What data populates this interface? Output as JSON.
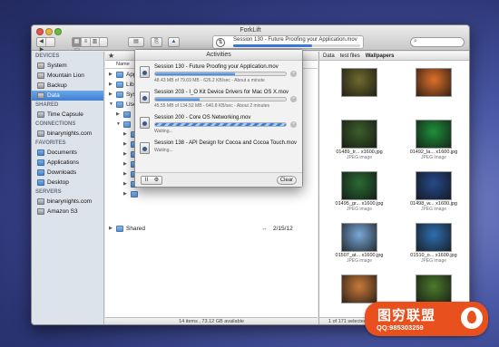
{
  "window": {
    "title": "ForkLift"
  },
  "toolbar": {
    "nav_back": "◀",
    "nav_forward": "▶",
    "search_icon": "search-icon",
    "search_glyph": "⌕"
  },
  "activity_status": {
    "label": "Session 130 - Future Proofing your Application.mov",
    "progress": 0.62,
    "icon": "⇅"
  },
  "sidebar": {
    "sections": [
      {
        "heading": "DEVICES",
        "items": [
          {
            "label": "System",
            "icon": "disk-icon"
          },
          {
            "label": "Mountain Lion",
            "icon": "disk-icon"
          },
          {
            "label": "Backup",
            "icon": "disk-icon"
          },
          {
            "label": "Data",
            "icon": "disk-icon",
            "selected": true
          }
        ]
      },
      {
        "heading": "SHARED",
        "items": [
          {
            "label": "Time Capsule",
            "icon": "network-icon"
          }
        ]
      },
      {
        "heading": "CONNECTIONS",
        "items": [
          {
            "label": "binarynights.com",
            "icon": "server-icon"
          }
        ]
      },
      {
        "heading": "FAVORITES",
        "items": [
          {
            "label": "Documents",
            "icon": "folder-icon"
          },
          {
            "label": "Applications",
            "icon": "folder-icon"
          },
          {
            "label": "Downloads",
            "icon": "folder-icon"
          },
          {
            "label": "Desktop",
            "icon": "folder-icon"
          }
        ]
      },
      {
        "heading": "SERVERS",
        "items": [
          {
            "label": "binarynights.com",
            "icon": "server-icon"
          },
          {
            "label": "Amazon S3",
            "icon": "server-icon"
          }
        ]
      }
    ]
  },
  "left_pane": {
    "column_name": "Name",
    "rows": [
      {
        "label": "App",
        "tri": "▶"
      },
      {
        "label": "Lib",
        "tri": "▶"
      },
      {
        "label": "Sys",
        "tri": "▶"
      },
      {
        "label": "Use",
        "tri": "▼"
      },
      {
        "label": "",
        "tri": "▶"
      },
      {
        "label": "",
        "tri": "▼"
      },
      {
        "label": "",
        "tri": "▶"
      },
      {
        "label": "",
        "tri": "▶"
      },
      {
        "label": "",
        "tri": "▶"
      },
      {
        "label": "",
        "tri": "▶"
      },
      {
        "label": "",
        "tri": "▶"
      },
      {
        "label": "",
        "tri": "▶"
      },
      {
        "label": "",
        "tri": "▶"
      },
      {
        "label": "Shared",
        "tri": "▶",
        "arrow": "↔",
        "date": "2/15/12"
      }
    ],
    "status": "14 items , 73.12 GB available"
  },
  "right_pane": {
    "crumbs": [
      "Data",
      "test files",
      "Wallpapers"
    ],
    "thumbnails": [
      {
        "name": "",
        "kind": "",
        "color": "#6f6a2e"
      },
      {
        "name": "",
        "kind": "",
        "color": "#e0702a"
      },
      {
        "name": "01489_tr... x1600.jpg",
        "kind": "JPEG image",
        "color": "#3d5e2a"
      },
      {
        "name": "01492_la... x1600.jpg",
        "kind": "JPEG image",
        "color": "#1f8f3a"
      },
      {
        "name": "01495_gr... x1600.jpg",
        "kind": "JPEG image",
        "color": "#2a6a34"
      },
      {
        "name": "01498_w... x1600.jpg",
        "kind": "JPEG image",
        "color": "#264a8a"
      },
      {
        "name": "01507_at... x1600.jpg",
        "kind": "JPEG image",
        "color": "#7aa9d8"
      },
      {
        "name": "01510_o... x1600.jpg",
        "kind": "JPEG image",
        "color": "#2e6fb0"
      },
      {
        "name": "",
        "kind": "",
        "color": "#c97a3a"
      },
      {
        "name": "",
        "kind": "",
        "color": "#4c7a2c"
      }
    ],
    "status": "1 of 171 selected  (10.71 GB, 17.8 MB)"
  },
  "activities": {
    "title": "Activities",
    "items": [
      {
        "name": "Session 130 - Future Proofing your Application.mov",
        "detail": "48.43 MB of 79.69 MB - 626.2 KB/sec - About a minute",
        "progress": 0.61,
        "stripe": false
      },
      {
        "name": "Session 203 - I_O Kit Device Drivers for Mac OS X.mov",
        "detail": "45.55 MB of 134.52 MB - 640.8 KB/sec - About 2 minutes",
        "progress": 0.34,
        "stripe": false
      },
      {
        "name": "Session 200 - Core OS Networking.mov",
        "detail": "Waiting...",
        "progress": 1.0,
        "stripe": true
      },
      {
        "name": "Session 138 - API Design for Cocoa and Cocoa Touch.mov",
        "detail": "Waiting...",
        "progress": 0,
        "stripe": false
      }
    ],
    "pause_glyph": "II",
    "gear_glyph": "⚙",
    "clear_label": "Clear",
    "cancel_glyph": "×"
  },
  "watermark": {
    "brand": "图穷联盟",
    "contact": "QQ:985303259"
  }
}
